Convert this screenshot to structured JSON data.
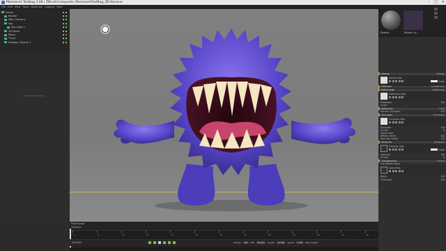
{
  "titlebar": {
    "title": "Marmoset Toolbag 3.08 | ZBrushComposite_MarmosetToolBag_3D.tbscene"
  },
  "menu": [
    "File",
    "Edit",
    "View",
    "Tools",
    "Materials",
    "Capture",
    "Help"
  ],
  "scene_tree": [
    {
      "label": "Scene",
      "indent": 0
    },
    {
      "label": "Render",
      "indent": 1
    },
    {
      "label": "Main Camera",
      "indent": 1
    },
    {
      "label": "Sky",
      "indent": 1
    },
    {
      "label": "Sky Light 1",
      "indent": 2
    },
    {
      "label": "3D Plane",
      "indent": 1
    },
    {
      "label": "Plane",
      "indent": 1
    },
    {
      "label": "Tmrvl",
      "indent": 1
    },
    {
      "label": "Shadow Catcher 1",
      "indent": 1
    }
  ],
  "material_preview": {
    "name1": "Default",
    "name2": "Blitzen Co..."
  },
  "properties": {
    "preset_field": "Surface",
    "sections": [
      {
        "kind": "head",
        "label": "Albedo",
        "right": "Albedo"
      },
      {
        "kind": "map",
        "title": "Albedo Map",
        "white": true,
        "val": "Color"
      },
      {
        "kind": "head",
        "label": "Diffusion",
        "right": "Lambertian"
      },
      {
        "kind": "head",
        "label": "Reflectivity",
        "right": "Metalness"
      },
      {
        "kind": "map",
        "title": "Metalness Map",
        "white": true,
        "val": ""
      },
      {
        "kind": "prop",
        "label": "Metalness",
        "val": "0.0"
      },
      {
        "kind": "prop",
        "label": "Invert",
        "val": ""
      },
      {
        "kind": "head",
        "label": "Reflection",
        "right": "GGX"
      },
      {
        "kind": "prop",
        "label": "Horizon Occlusion",
        "val": "0.0"
      },
      {
        "kind": "head",
        "label": "Occlusion",
        "right": "Occlusion"
      },
      {
        "kind": "map",
        "title": "Occlusion Map",
        "white": true,
        "val": ""
      },
      {
        "kind": "prop",
        "label": "Occlusion",
        "val": "1.0"
      },
      {
        "kind": "prop",
        "label": "UV Set",
        "val": "0"
      },
      {
        "kind": "prop",
        "label": "Cavity Map",
        "val": ""
      },
      {
        "kind": "prop",
        "label": "Diffuse Cavity",
        "val": "0.0"
      },
      {
        "kind": "prop",
        "label": "Specular Cavity",
        "val": "1.0"
      },
      {
        "kind": "head",
        "label": "Emissive",
        "right": "Emissive"
      },
      {
        "kind": "map",
        "title": "Emissive Map",
        "white": false,
        "val": "Color"
      },
      {
        "kind": "prop",
        "label": "Intensity",
        "val": "0.0"
      },
      {
        "kind": "prop",
        "label": "UV Set",
        "val": "0"
      },
      {
        "kind": "head",
        "label": "Transparency",
        "right": "Cutout"
      },
      {
        "kind": "prop",
        "label": "Use Albedo Alpha",
        "val": ""
      },
      {
        "kind": "map",
        "title": "Alpha Map",
        "white": false,
        "val": ""
      },
      {
        "kind": "prop",
        "label": "Alpha",
        "val": "1.0"
      },
      {
        "kind": "prop",
        "label": "Threshold",
        "val": "0.0"
      }
    ]
  },
  "timeline": {
    "label1": "Pla/Preview",
    "label2": "Timeline",
    "frame": "0:00.0/1",
    "ruler": [
      "0",
      "5",
      "10",
      "15",
      "20",
      "25",
      "30",
      "35",
      "40",
      "45",
      "50",
      "55",
      "60"
    ],
    "stats": [
      {
        "k": "Frames",
        "v": "300"
      },
      {
        "k": "FPS",
        "v": "30.000"
      },
      {
        "k": "Length",
        "v": "10.000"
      },
      {
        "k": "Speed",
        "v": "1.000"
      },
      {
        "k": "Bake Speed",
        "v": ""
      }
    ]
  },
  "colors": {
    "monster_body": "#5b4bd0",
    "monster_fur": "#7a60e0",
    "mouth": "#3a0d1c",
    "tongue": "#c7456b",
    "teeth": "#f3e6c0",
    "accent": "#d98a2a"
  }
}
